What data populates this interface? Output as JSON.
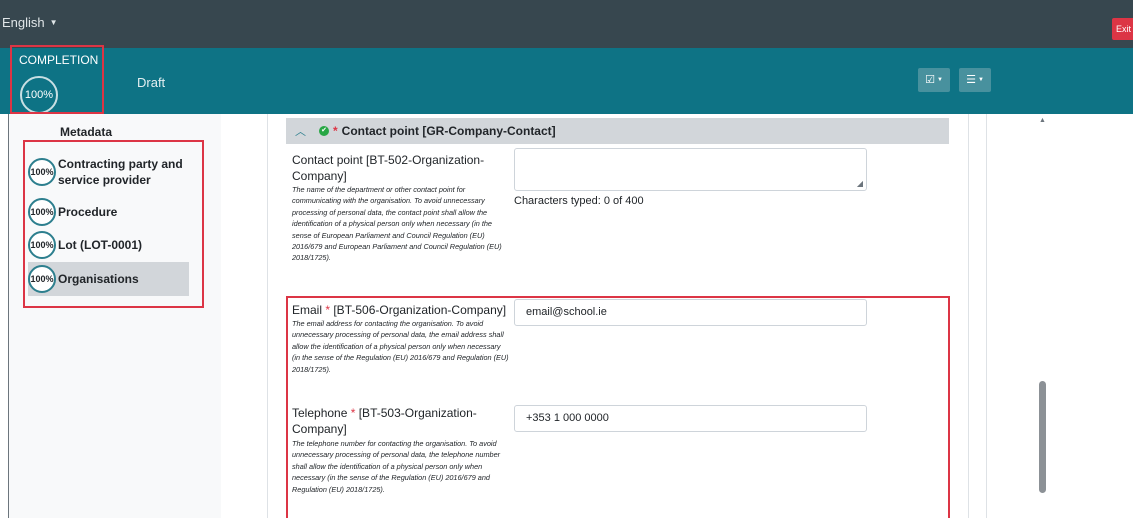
{
  "topbar": {
    "language": "English",
    "exit_label": "Exit"
  },
  "status": {
    "completion_label": "COMPLETION",
    "completion_value": "100%",
    "state": "Draft",
    "tool1_icon": "checkbox-dropdown-icon",
    "tool2_icon": "sliders-dropdown-icon"
  },
  "sidebar": {
    "title": "Metadata",
    "items": [
      {
        "percent": "100%",
        "label": "Contracting party and service provider"
      },
      {
        "percent": "100%",
        "label": "Procedure"
      },
      {
        "percent": "100%",
        "label": "Lot (LOT-0001)"
      },
      {
        "percent": "100%",
        "label": "Organisations"
      }
    ]
  },
  "section": {
    "required_mark": "*",
    "title": "Contact point  [GR-Company-Contact]"
  },
  "fields": {
    "contact_point": {
      "label": "Contact point [BT-502-Organization-Company]",
      "description": "The name of the department or other contact point for communicating with the organisation. To avoid unnecessary processing of personal data, the contact point shall allow the identification of a physical person only when necessary (in the sense of European Parliament and Council Regulation (EU) 2016/679 and European Parliament and Council Regulation (EU) 2018/1725).",
      "value": "",
      "char_count": "Characters typed: 0 of 400"
    },
    "email": {
      "label_prefix": "Email ",
      "required": "*",
      "label_suffix": " [BT-506-Organization-Company]",
      "description": "The email address for contacting the organisation. To avoid unnecessary processing of personal data, the email address shall allow the identification of a physical person only when necessary (in the sense of the Regulation (EU) 2016/679 and Regulation (EU) 2018/1725).",
      "value": "email@school.ie"
    },
    "telephone": {
      "label_prefix": "Telephone ",
      "required": "*",
      "label_suffix": " [BT-503-Organization-Company]",
      "description": "The telephone number for contacting the organisation. To avoid unnecessary processing of personal data, the telephone number shall allow the identification of a physical person only when necessary (in the sense of the Regulation (EU) 2016/679 and Regulation (EU) 2018/1725).",
      "value": "+353 1 000 0000"
    }
  },
  "colors": {
    "topbar": "#37474f",
    "statusbar": "#0e7385",
    "highlight": "#dc3545",
    "required": "#dc3545",
    "valid": "#28a745"
  }
}
